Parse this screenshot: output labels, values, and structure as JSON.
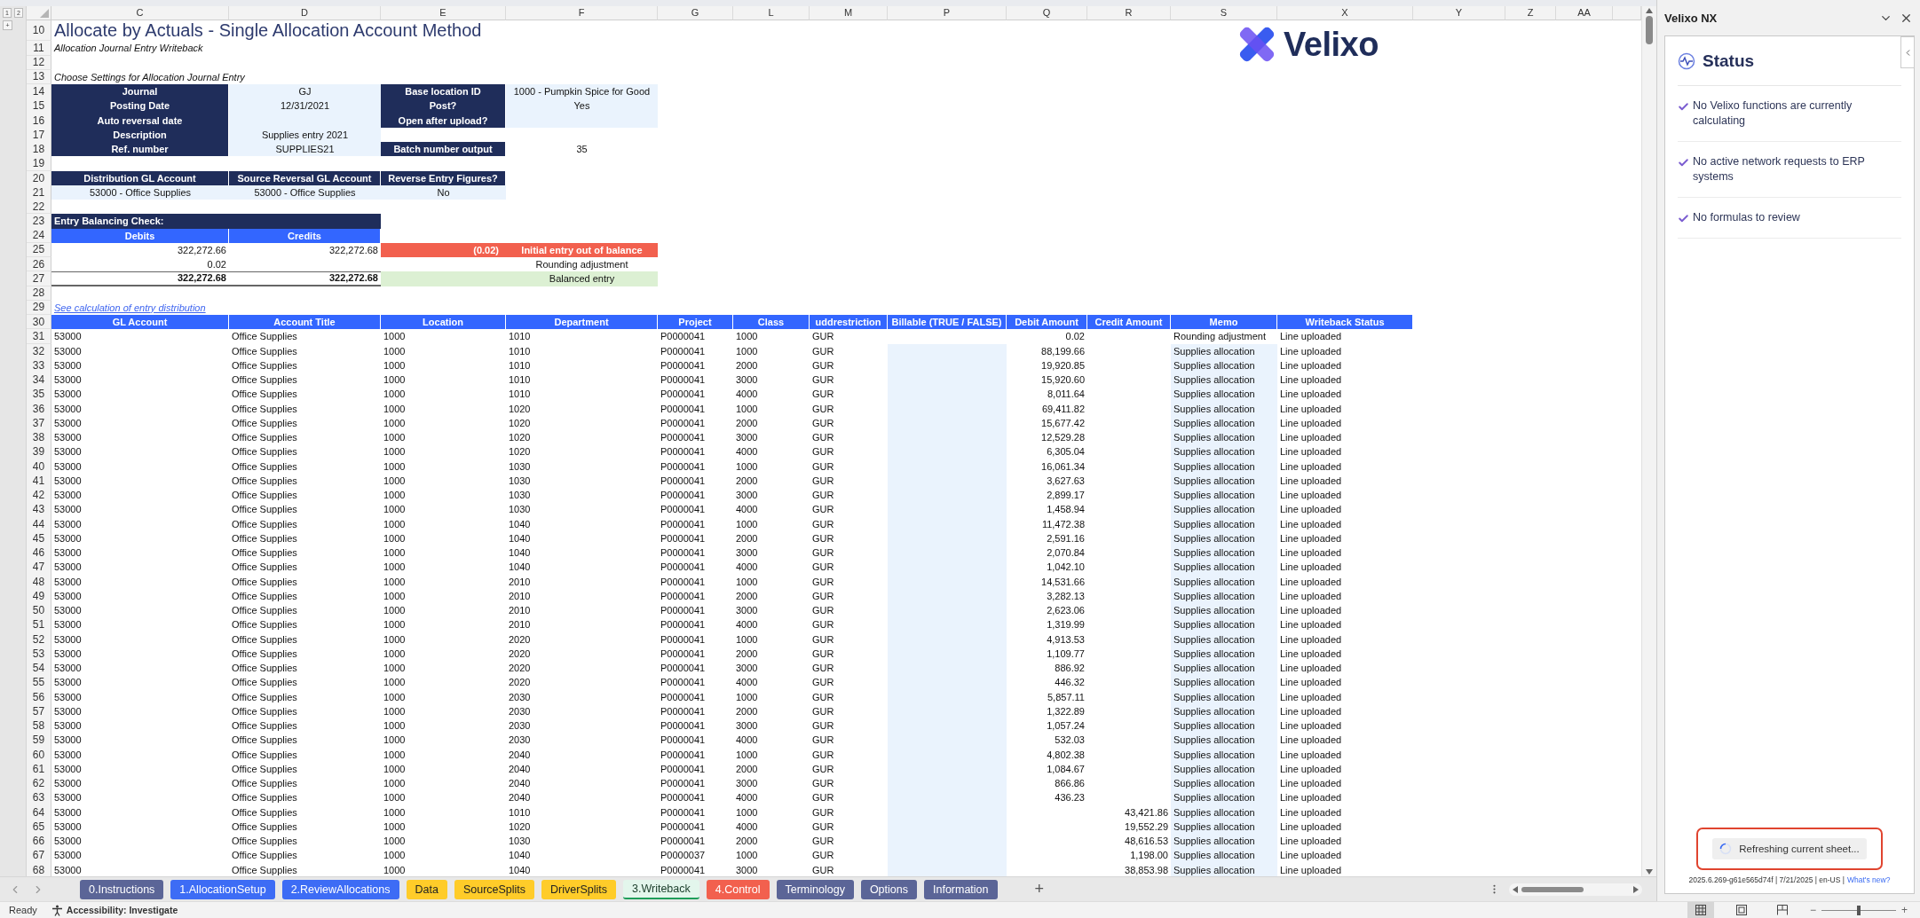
{
  "sheet": {
    "outline_levels": [
      "1",
      "2"
    ],
    "outline_toggle": "+",
    "columns": [
      "C",
      "D",
      "E",
      "F",
      "G",
      "L",
      "M",
      "P",
      "Q",
      "R",
      "S",
      "X",
      "Y",
      "Z",
      "AA"
    ],
    "logo": {
      "text": "Velixo"
    },
    "rows": [
      {
        "row": "10",
        "kind": "title",
        "text": "Allocate by Actuals - Single Allocation Account Method"
      },
      {
        "row": "11",
        "kind": "caption",
        "text": "Allocation Journal Entry Writeback"
      },
      {
        "row": "12",
        "kind": "blank"
      },
      {
        "row": "13",
        "kind": "caption",
        "text": "Choose Settings for Allocation Journal Entry"
      },
      {
        "row": "14",
        "kind": "setting",
        "label": "Journal",
        "value": "GJ",
        "label_2": "Base location ID",
        "value_2": "1000 - Pumpkin Spice for Good",
        "value_2_editable": true
      },
      {
        "row": "15",
        "kind": "setting",
        "label": "Posting Date",
        "value": "12/31/2021",
        "label_2": "Post?",
        "value_2": "Yes",
        "value_2_editable": true
      },
      {
        "row": "16",
        "kind": "setting",
        "label": "Auto reversal date",
        "label_2": "Open after upload?",
        "value_2_editable": true
      },
      {
        "row": "17",
        "kind": "setting",
        "label": "Description",
        "value": "Supplies entry 2021"
      },
      {
        "row": "18",
        "kind": "setting",
        "label": "Ref. number",
        "value": "SUPPLIES21",
        "label_2": "Batch number output",
        "value_2": "35",
        "value_2_editable": false
      },
      {
        "row": "19",
        "kind": "blank"
      },
      {
        "row": "20",
        "kind": "labels",
        "labels": [
          "Distribution GL Account",
          "Source Reversal GL Account",
          "Reverse Entry Figures?"
        ]
      },
      {
        "row": "21",
        "kind": "values",
        "values": [
          "53000 - Office Supplies",
          "53000 - Office Supplies",
          "No"
        ]
      },
      {
        "row": "22",
        "kind": "blank"
      },
      {
        "row": "23",
        "kind": "section",
        "text": "Entry Balancing Check:"
      },
      {
        "row": "24",
        "kind": "column_labels",
        "labels": [
          "Debits",
          "Credits"
        ]
      },
      {
        "row": "25",
        "kind": "balance",
        "debit": "322,272.66",
        "credit": "322,272.68",
        "difference": "(0.02)",
        "message": "Initial entry out of balance",
        "out_of_balance": true,
        "balanced": false,
        "total": false
      },
      {
        "row": "26",
        "kind": "balance",
        "debit": "0.02",
        "message": "Rounding adjustment",
        "out_of_balance": false,
        "balanced": false,
        "total": false
      },
      {
        "row": "27",
        "kind": "balance",
        "debit": "322,272.68",
        "credit": "322,272.68",
        "message": "Balanced entry",
        "out_of_balance": false,
        "balanced": true,
        "total": true
      },
      {
        "row": "28",
        "kind": "blank"
      },
      {
        "row": "29",
        "kind": "link",
        "text": "See calculation of entry distribution"
      }
    ],
    "table": {
      "header_row": "30",
      "columns": [
        "GL Account",
        "Account Title",
        "Location",
        "Department",
        "Project",
        "Class",
        "uddrestriction",
        "Billable (TRUE / FALSE)",
        "Debit Amount",
        "Credit Amount",
        "Memo",
        "Writeback Status"
      ],
      "rows": [
        {
          "row": "31",
          "kind": "adjustment",
          "gl_account": "53000",
          "account_title": "Office Supplies",
          "location": "1000",
          "department": "1010",
          "project": "P0000041",
          "class": "1000",
          "restriction": "GUR",
          "debit": "0.02",
          "memo": "Rounding adjustment",
          "status": "Line uploaded"
        },
        {
          "row": "32",
          "kind": "allocation",
          "gl_account": "53000",
          "account_title": "Office Supplies",
          "location": "1000",
          "department": "1010",
          "project": "P0000041",
          "class": "1000",
          "restriction": "GUR",
          "debit": "88,199.66",
          "memo": "Supplies allocation",
          "status": "Line uploaded"
        },
        {
          "row": "33",
          "kind": "allocation",
          "gl_account": "53000",
          "account_title": "Office Supplies",
          "location": "1000",
          "department": "1010",
          "project": "P0000041",
          "class": "2000",
          "restriction": "GUR",
          "debit": "19,920.85",
          "memo": "Supplies allocation",
          "status": "Line uploaded"
        },
        {
          "row": "34",
          "kind": "allocation",
          "gl_account": "53000",
          "account_title": "Office Supplies",
          "location": "1000",
          "department": "1010",
          "project": "P0000041",
          "class": "3000",
          "restriction": "GUR",
          "debit": "15,920.60",
          "memo": "Supplies allocation",
          "status": "Line uploaded"
        },
        {
          "row": "35",
          "kind": "allocation",
          "gl_account": "53000",
          "account_title": "Office Supplies",
          "location": "1000",
          "department": "1010",
          "project": "P0000041",
          "class": "4000",
          "restriction": "GUR",
          "debit": "8,011.64",
          "memo": "Supplies allocation",
          "status": "Line uploaded"
        },
        {
          "row": "36",
          "kind": "allocation",
          "gl_account": "53000",
          "account_title": "Office Supplies",
          "location": "1000",
          "department": "1020",
          "project": "P0000041",
          "class": "1000",
          "restriction": "GUR",
          "debit": "69,411.82",
          "memo": "Supplies allocation",
          "status": "Line uploaded"
        },
        {
          "row": "37",
          "kind": "allocation",
          "gl_account": "53000",
          "account_title": "Office Supplies",
          "location": "1000",
          "department": "1020",
          "project": "P0000041",
          "class": "2000",
          "restriction": "GUR",
          "debit": "15,677.42",
          "memo": "Supplies allocation",
          "status": "Line uploaded"
        },
        {
          "row": "38",
          "kind": "allocation",
          "gl_account": "53000",
          "account_title": "Office Supplies",
          "location": "1000",
          "department": "1020",
          "project": "P0000041",
          "class": "3000",
          "restriction": "GUR",
          "debit": "12,529.28",
          "memo": "Supplies allocation",
          "status": "Line uploaded"
        },
        {
          "row": "39",
          "kind": "allocation",
          "gl_account": "53000",
          "account_title": "Office Supplies",
          "location": "1000",
          "department": "1020",
          "project": "P0000041",
          "class": "4000",
          "restriction": "GUR",
          "debit": "6,305.04",
          "memo": "Supplies allocation",
          "status": "Line uploaded"
        },
        {
          "row": "40",
          "kind": "allocation",
          "gl_account": "53000",
          "account_title": "Office Supplies",
          "location": "1000",
          "department": "1030",
          "project": "P0000041",
          "class": "1000",
          "restriction": "GUR",
          "debit": "16,061.34",
          "memo": "Supplies allocation",
          "status": "Line uploaded"
        },
        {
          "row": "41",
          "kind": "allocation",
          "gl_account": "53000",
          "account_title": "Office Supplies",
          "location": "1000",
          "department": "1030",
          "project": "P0000041",
          "class": "2000",
          "restriction": "GUR",
          "debit": "3,627.63",
          "memo": "Supplies allocation",
          "status": "Line uploaded"
        },
        {
          "row": "42",
          "kind": "allocation",
          "gl_account": "53000",
          "account_title": "Office Supplies",
          "location": "1000",
          "department": "1030",
          "project": "P0000041",
          "class": "3000",
          "restriction": "GUR",
          "debit": "2,899.17",
          "memo": "Supplies allocation",
          "status": "Line uploaded"
        },
        {
          "row": "43",
          "kind": "allocation",
          "gl_account": "53000",
          "account_title": "Office Supplies",
          "location": "1000",
          "department": "1030",
          "project": "P0000041",
          "class": "4000",
          "restriction": "GUR",
          "debit": "1,458.94",
          "memo": "Supplies allocation",
          "status": "Line uploaded"
        },
        {
          "row": "44",
          "kind": "allocation",
          "gl_account": "53000",
          "account_title": "Office Supplies",
          "location": "1000",
          "department": "1040",
          "project": "P0000041",
          "class": "1000",
          "restriction": "GUR",
          "debit": "11,472.38",
          "memo": "Supplies allocation",
          "status": "Line uploaded"
        },
        {
          "row": "45",
          "kind": "allocation",
          "gl_account": "53000",
          "account_title": "Office Supplies",
          "location": "1000",
          "department": "1040",
          "project": "P0000041",
          "class": "2000",
          "restriction": "GUR",
          "debit": "2,591.16",
          "memo": "Supplies allocation",
          "status": "Line uploaded"
        },
        {
          "row": "46",
          "kind": "allocation",
          "gl_account": "53000",
          "account_title": "Office Supplies",
          "location": "1000",
          "department": "1040",
          "project": "P0000041",
          "class": "3000",
          "restriction": "GUR",
          "debit": "2,070.84",
          "memo": "Supplies allocation",
          "status": "Line uploaded"
        },
        {
          "row": "47",
          "kind": "allocation",
          "gl_account": "53000",
          "account_title": "Office Supplies",
          "location": "1000",
          "department": "1040",
          "project": "P0000041",
          "class": "4000",
          "restriction": "GUR",
          "debit": "1,042.10",
          "memo": "Supplies allocation",
          "status": "Line uploaded"
        },
        {
          "row": "48",
          "kind": "allocation",
          "gl_account": "53000",
          "account_title": "Office Supplies",
          "location": "1000",
          "department": "2010",
          "project": "P0000041",
          "class": "1000",
          "restriction": "GUR",
          "debit": "14,531.66",
          "memo": "Supplies allocation",
          "status": "Line uploaded"
        },
        {
          "row": "49",
          "kind": "allocation",
          "gl_account": "53000",
          "account_title": "Office Supplies",
          "location": "1000",
          "department": "2010",
          "project": "P0000041",
          "class": "2000",
          "restriction": "GUR",
          "debit": "3,282.13",
          "memo": "Supplies allocation",
          "status": "Line uploaded"
        },
        {
          "row": "50",
          "kind": "allocation",
          "gl_account": "53000",
          "account_title": "Office Supplies",
          "location": "1000",
          "department": "2010",
          "project": "P0000041",
          "class": "3000",
          "restriction": "GUR",
          "debit": "2,623.06",
          "memo": "Supplies allocation",
          "status": "Line uploaded"
        },
        {
          "row": "51",
          "kind": "allocation",
          "gl_account": "53000",
          "account_title": "Office Supplies",
          "location": "1000",
          "department": "2010",
          "project": "P0000041",
          "class": "4000",
          "restriction": "GUR",
          "debit": "1,319.99",
          "memo": "Supplies allocation",
          "status": "Line uploaded"
        },
        {
          "row": "52",
          "kind": "allocation",
          "gl_account": "53000",
          "account_title": "Office Supplies",
          "location": "1000",
          "department": "2020",
          "project": "P0000041",
          "class": "1000",
          "restriction": "GUR",
          "debit": "4,913.53",
          "memo": "Supplies allocation",
          "status": "Line uploaded"
        },
        {
          "row": "53",
          "kind": "allocation",
          "gl_account": "53000",
          "account_title": "Office Supplies",
          "location": "1000",
          "department": "2020",
          "project": "P0000041",
          "class": "2000",
          "restriction": "GUR",
          "debit": "1,109.77",
          "memo": "Supplies allocation",
          "status": "Line uploaded"
        },
        {
          "row": "54",
          "kind": "allocation",
          "gl_account": "53000",
          "account_title": "Office Supplies",
          "location": "1000",
          "department": "2020",
          "project": "P0000041",
          "class": "3000",
          "restriction": "GUR",
          "debit": "886.92",
          "memo": "Supplies allocation",
          "status": "Line uploaded"
        },
        {
          "row": "55",
          "kind": "allocation",
          "gl_account": "53000",
          "account_title": "Office Supplies",
          "location": "1000",
          "department": "2020",
          "project": "P0000041",
          "class": "4000",
          "restriction": "GUR",
          "debit": "446.32",
          "memo": "Supplies allocation",
          "status": "Line uploaded"
        },
        {
          "row": "56",
          "kind": "allocation",
          "gl_account": "53000",
          "account_title": "Office Supplies",
          "location": "1000",
          "department": "2030",
          "project": "P0000041",
          "class": "1000",
          "restriction": "GUR",
          "debit": "5,857.11",
          "memo": "Supplies allocation",
          "status": "Line uploaded"
        },
        {
          "row": "57",
          "kind": "allocation",
          "gl_account": "53000",
          "account_title": "Office Supplies",
          "location": "1000",
          "department": "2030",
          "project": "P0000041",
          "class": "2000",
          "restriction": "GUR",
          "debit": "1,322.89",
          "memo": "Supplies allocation",
          "status": "Line uploaded"
        },
        {
          "row": "58",
          "kind": "allocation",
          "gl_account": "53000",
          "account_title": "Office Supplies",
          "location": "1000",
          "department": "2030",
          "project": "P0000041",
          "class": "3000",
          "restriction": "GUR",
          "debit": "1,057.24",
          "memo": "Supplies allocation",
          "status": "Line uploaded"
        },
        {
          "row": "59",
          "kind": "allocation",
          "gl_account": "53000",
          "account_title": "Office Supplies",
          "location": "1000",
          "department": "2030",
          "project": "P0000041",
          "class": "4000",
          "restriction": "GUR",
          "debit": "532.03",
          "memo": "Supplies allocation",
          "status": "Line uploaded"
        },
        {
          "row": "60",
          "kind": "allocation",
          "gl_account": "53000",
          "account_title": "Office Supplies",
          "location": "1000",
          "department": "2040",
          "project": "P0000041",
          "class": "1000",
          "restriction": "GUR",
          "debit": "4,802.38",
          "memo": "Supplies allocation",
          "status": "Line uploaded"
        },
        {
          "row": "61",
          "kind": "allocation",
          "gl_account": "53000",
          "account_title": "Office Supplies",
          "location": "1000",
          "department": "2040",
          "project": "P0000041",
          "class": "2000",
          "restriction": "GUR",
          "debit": "1,084.67",
          "memo": "Supplies allocation",
          "status": "Line uploaded"
        },
        {
          "row": "62",
          "kind": "allocation",
          "gl_account": "53000",
          "account_title": "Office Supplies",
          "location": "1000",
          "department": "2040",
          "project": "P0000041",
          "class": "3000",
          "restriction": "GUR",
          "debit": "866.86",
          "memo": "Supplies allocation",
          "status": "Line uploaded"
        },
        {
          "row": "63",
          "kind": "allocation",
          "gl_account": "53000",
          "account_title": "Office Supplies",
          "location": "1000",
          "department": "2040",
          "project": "P0000041",
          "class": "4000",
          "restriction": "GUR",
          "debit": "436.23",
          "memo": "Supplies allocation",
          "status": "Line uploaded"
        },
        {
          "row": "64",
          "kind": "allocation",
          "gl_account": "53000",
          "account_title": "Office Supplies",
          "location": "1000",
          "department": "1010",
          "project": "P0000041",
          "class": "1000",
          "restriction": "GUR",
          "credit": "43,421.86",
          "memo": "Supplies allocation",
          "status": "Line uploaded"
        },
        {
          "row": "65",
          "kind": "allocation",
          "gl_account": "53000",
          "account_title": "Office Supplies",
          "location": "1000",
          "department": "1020",
          "project": "P0000041",
          "class": "4000",
          "restriction": "GUR",
          "credit": "19,552.29",
          "memo": "Supplies allocation",
          "status": "Line uploaded"
        },
        {
          "row": "66",
          "kind": "allocation",
          "gl_account": "53000",
          "account_title": "Office Supplies",
          "location": "1000",
          "department": "1030",
          "project": "P0000041",
          "class": "2000",
          "restriction": "GUR",
          "credit": "48,616.53",
          "memo": "Supplies allocation",
          "status": "Line uploaded"
        },
        {
          "row": "67",
          "kind": "allocation",
          "gl_account": "53000",
          "account_title": "Office Supplies",
          "location": "1000",
          "department": "1040",
          "project": "P0000037",
          "class": "1000",
          "restriction": "GUR",
          "credit": "1,198.00",
          "memo": "Supplies allocation",
          "status": "Line uploaded"
        },
        {
          "row": "68",
          "kind": "allocation",
          "gl_account": "53000",
          "account_title": "Office Supplies",
          "location": "1000",
          "department": "1040",
          "project": "P0000041",
          "class": "3000",
          "restriction": "GUR",
          "credit": "38,853.98",
          "memo": "Supplies allocation",
          "status": "Line uploaded"
        }
      ]
    }
  },
  "sheet_tabs": [
    {
      "label": "0.Instructions",
      "color": "#5b6597",
      "selected": false
    },
    {
      "label": "1.AllocationSetup",
      "color": "#3d6cf5",
      "selected": false
    },
    {
      "label": "2.ReviewAllocations",
      "color": "#3d6cf5",
      "selected": false
    },
    {
      "label": "Data",
      "color": "#ffcc29",
      "selected": false
    },
    {
      "label": "SourceSplits",
      "color": "#ffcc29",
      "selected": false
    },
    {
      "label": "DriverSplits",
      "color": "#ffcc29",
      "selected": false
    },
    {
      "label": "3.Writeback",
      "color": "#1e9e5a",
      "selected": true
    },
    {
      "label": "4.Control",
      "color": "#f2604e",
      "selected": false
    },
    {
      "label": "Terminology",
      "color": "#5b6597",
      "selected": false
    },
    {
      "label": "Options",
      "color": "#5b6597",
      "selected": false
    },
    {
      "label": "Information",
      "color": "#5b6597",
      "selected": false
    }
  ],
  "add_sheet": "+",
  "panel": {
    "title": "Velixo NX",
    "heading": "Status",
    "items": [
      "No Velixo functions are currently calculating",
      "No active network requests to ERP systems",
      "No formulas to review"
    ],
    "progress": "Refreshing current sheet...",
    "footer": {
      "text": "2025.6.269-g61e565d74f | 7/21/2025 | en-US |",
      "link": "What's new?"
    }
  },
  "status_bar": {
    "status": "Ready",
    "accessibility": "Accessibility: Investigate",
    "views": [
      {
        "kind": "normal",
        "selected": true
      },
      {
        "kind": "page_layout",
        "selected": false
      },
      {
        "kind": "page_break",
        "selected": false
      }
    ],
    "zoom": {
      "minus": "−",
      "plus": "+",
      "level": 0.5
    }
  }
}
